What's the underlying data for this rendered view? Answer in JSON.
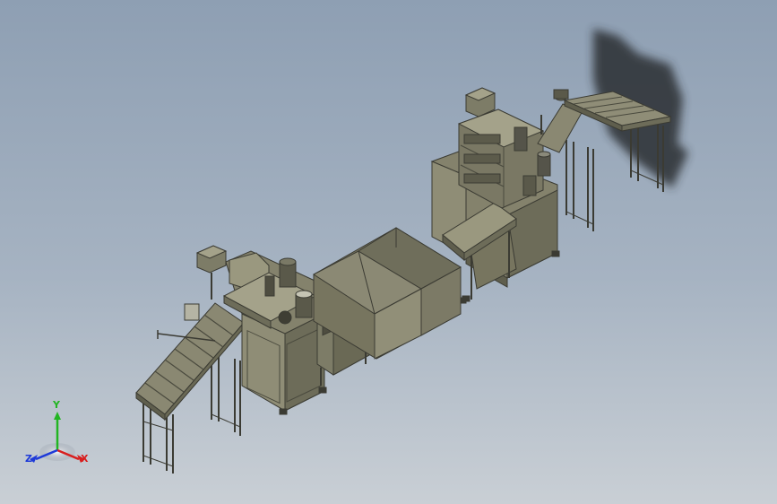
{
  "viewport": {
    "background_top": "#8e9fb3",
    "background_bottom": "#c9cfd5",
    "body_color": "#84826c",
    "body_dark": "#5f5e4d",
    "body_light": "#a4a28a",
    "frame_color": "#3b3b33",
    "shadow_color": "#2a2e33"
  },
  "triad": {
    "x_label": "X",
    "y_label": "Y",
    "z_label": "Z",
    "x_color": "#d81e1e",
    "y_color": "#22b522",
    "z_color": "#1e3ad8"
  }
}
